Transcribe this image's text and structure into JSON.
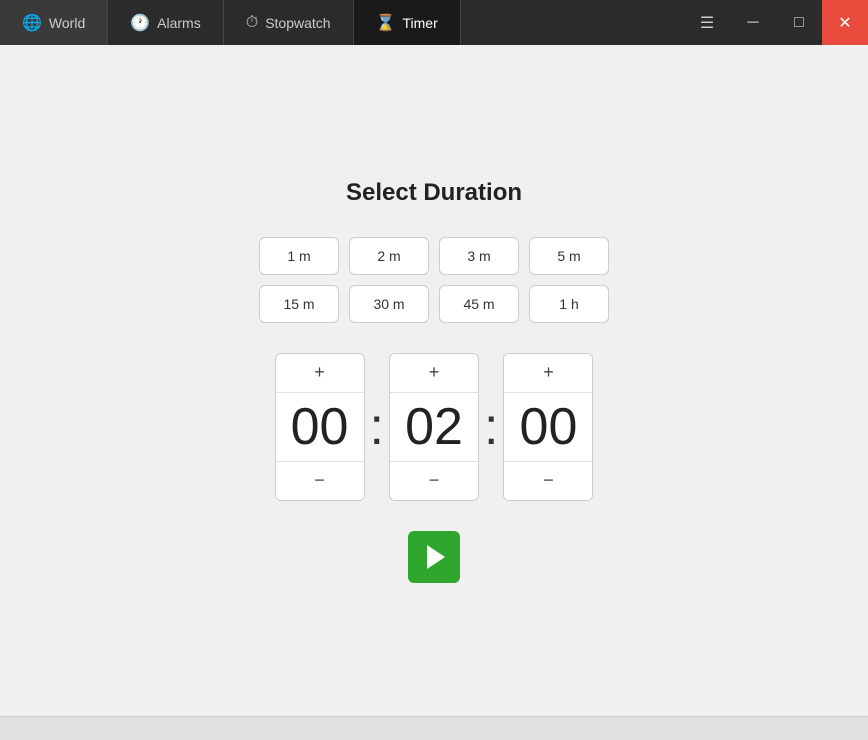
{
  "titlebar": {
    "tabs": [
      {
        "id": "world",
        "label": "World",
        "icon": "🌐",
        "active": false
      },
      {
        "id": "alarms",
        "label": "Alarms",
        "icon": "🕐",
        "active": false
      },
      {
        "id": "stopwatch",
        "label": "Stopwatch",
        "icon": "⏱",
        "active": false
      },
      {
        "id": "timer",
        "label": "Timer",
        "icon": "⌛",
        "active": true
      }
    ],
    "controls": {
      "hamburger": "☰",
      "minimize": "─",
      "maximize": "□",
      "close": "✕"
    }
  },
  "main": {
    "title": "Select Duration",
    "duration_buttons": [
      "1 m",
      "2 m",
      "3 m",
      "5 m",
      "15 m",
      "30 m",
      "45 m",
      "1 h"
    ],
    "time": {
      "hours": "00",
      "minutes": "02",
      "seconds": "00"
    },
    "play_label": "▶"
  }
}
